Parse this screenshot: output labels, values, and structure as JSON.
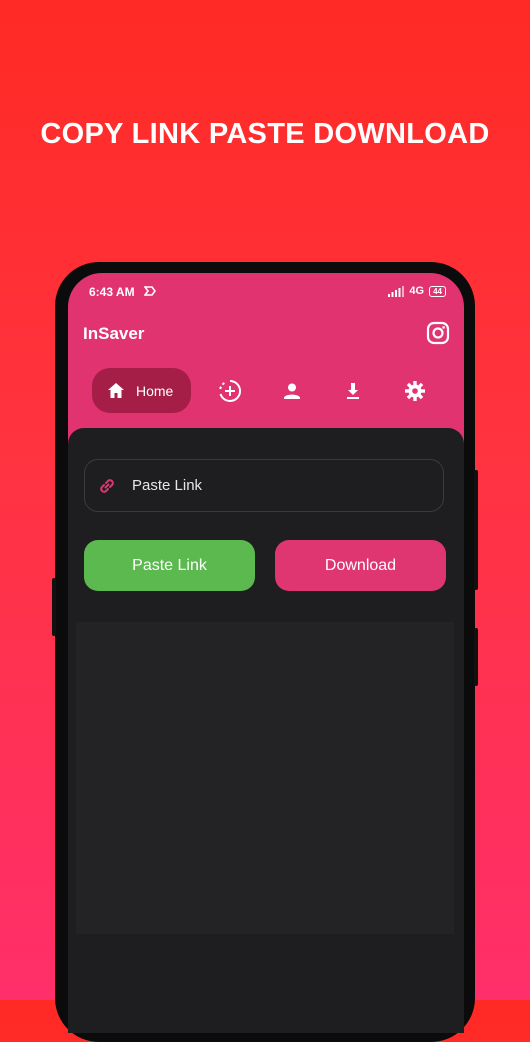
{
  "headline": "COPY LINK PASTE DOWNLOAD",
  "status_bar": {
    "time": "6:43 AM",
    "network": "4G",
    "battery": "44"
  },
  "app": {
    "title": "InSaver"
  },
  "nav": {
    "items": [
      {
        "label": "Home",
        "icon": "home-icon",
        "active": true
      },
      {
        "icon": "add-story-icon"
      },
      {
        "icon": "person-icon"
      },
      {
        "icon": "download-icon"
      },
      {
        "icon": "gear-icon"
      }
    ]
  },
  "link_input": {
    "placeholder": "Paste Link",
    "icon": "link-icon"
  },
  "buttons": {
    "paste_label": "Paste Link",
    "download_label": "Download"
  },
  "colors": {
    "background_top": "#ff2a25",
    "background_bottom": "#ff2f6a",
    "app_bar": "#e0336f",
    "nav_active": "#a41e48",
    "content_bg": "#1e1e21",
    "paste_button": "#5cb94f",
    "download_button": "#df3570"
  }
}
